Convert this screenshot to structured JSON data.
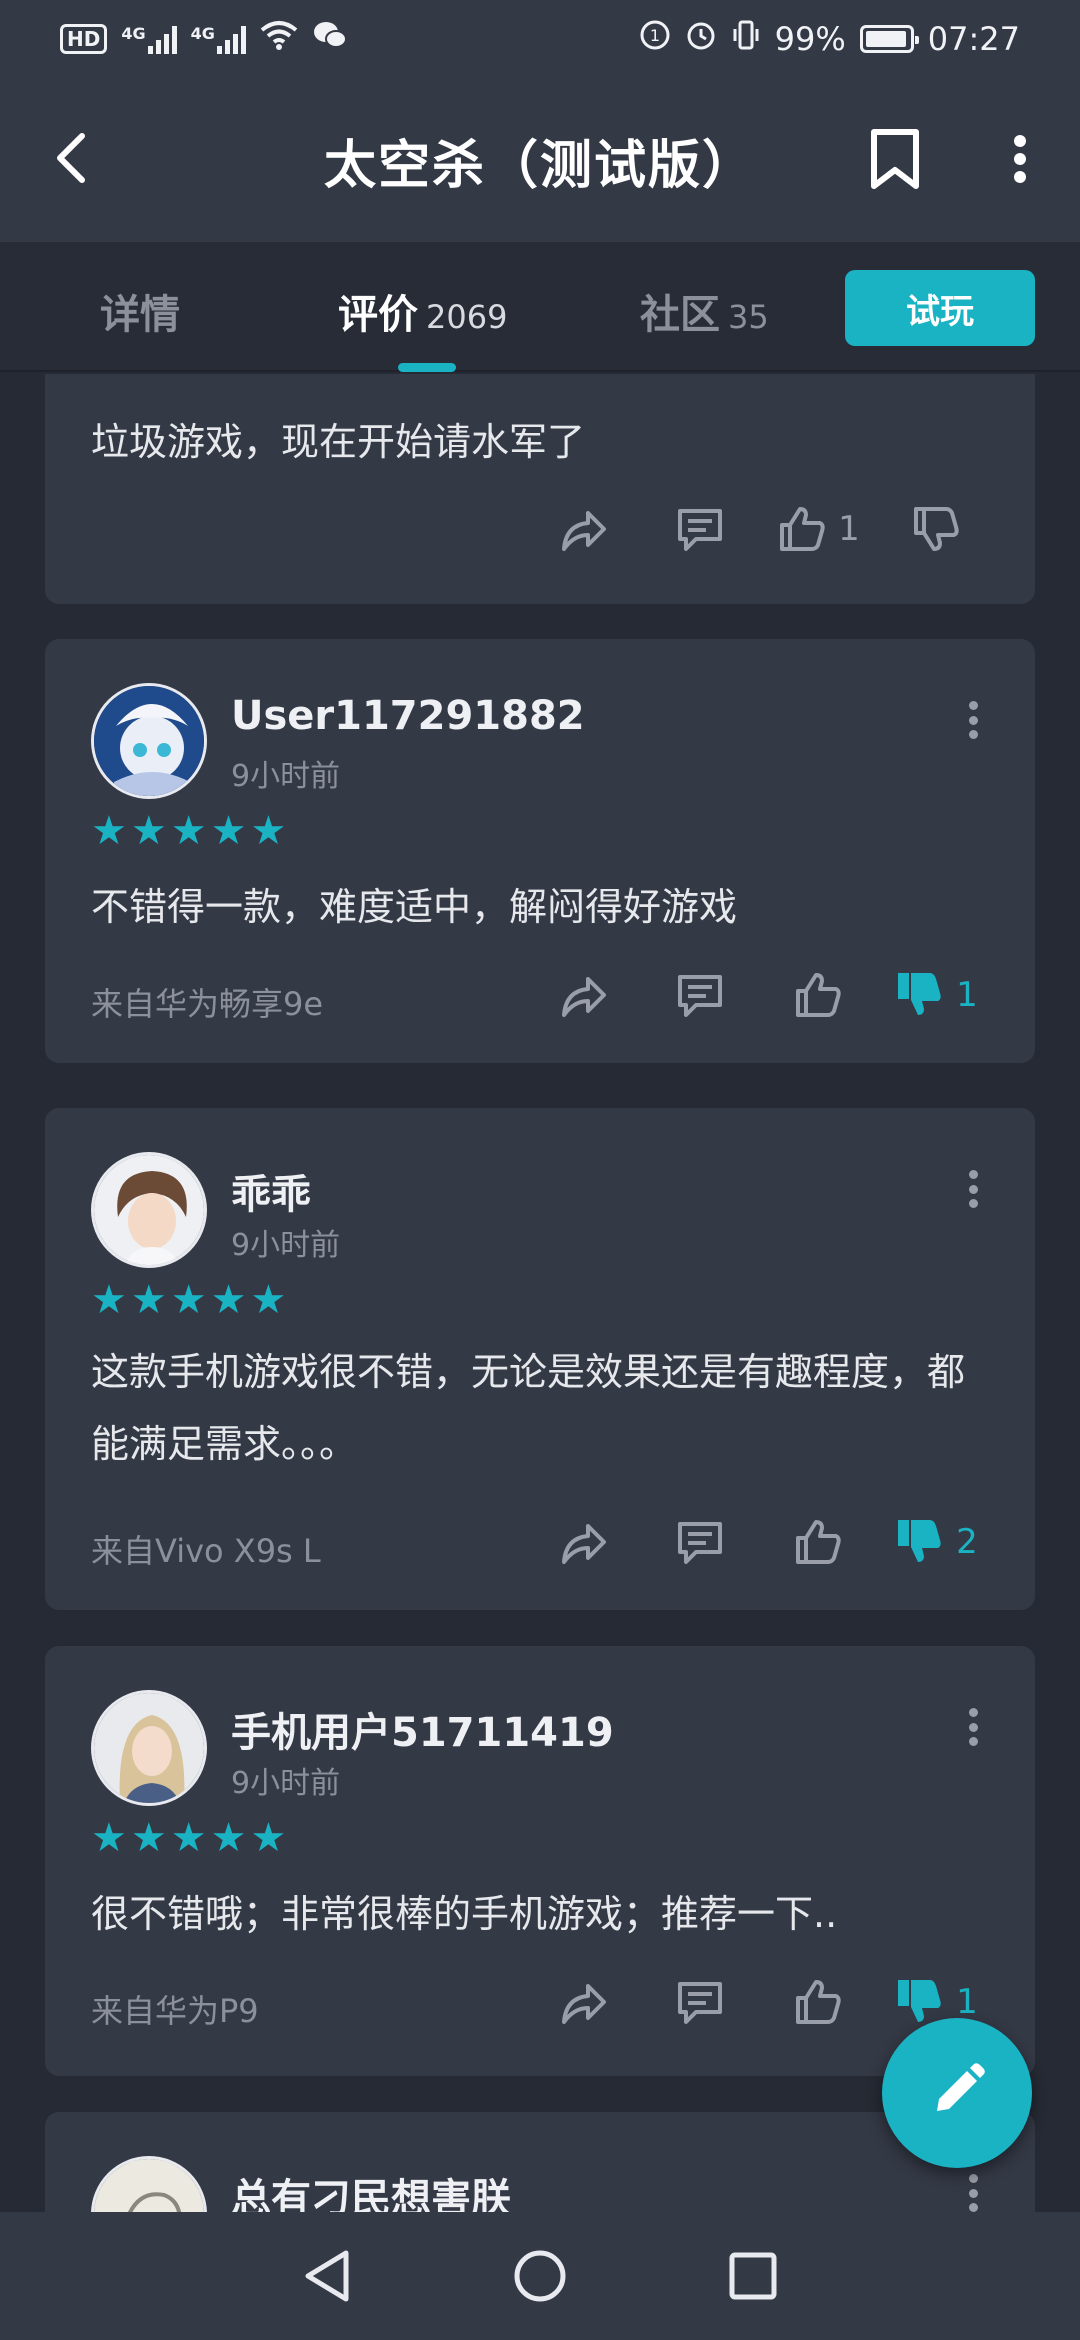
{
  "status_bar": {
    "hd": "HD",
    "net1": "4G",
    "net2": "4G",
    "battery": "99%",
    "time": "07:27"
  },
  "header": {
    "title": "太空杀（测试版）"
  },
  "tabs": [
    {
      "label": "详情",
      "count": ""
    },
    {
      "label": "评价",
      "count": "2069"
    },
    {
      "label": "社区",
      "count": "35"
    }
  ],
  "try_button": "试玩",
  "reviews": [
    {
      "text": "垃圾游戏，现在开始请水军了",
      "likes": "1",
      "dislikes": ""
    },
    {
      "name": "User117291882",
      "time": "9小时前",
      "rating": 5,
      "text": "不错得一款，难度适中，解闷得好游戏",
      "device": "来自华为畅享9e",
      "likes": "",
      "dislikes": "1"
    },
    {
      "name": "乖乖",
      "time": "9小时前",
      "rating": 5,
      "text": "这款手机游戏很不错，无论是效果还是有趣程度，都能满足需求。。。",
      "device": "来自Vivo X9s L",
      "likes": "",
      "dislikes": "2"
    },
    {
      "name": "手机用户51711419",
      "time": "9小时前",
      "rating": 5,
      "text": "很不错哦；非常很棒的手机游戏；推荐一下..",
      "device": "来自华为P9",
      "likes": "",
      "dislikes": "1"
    },
    {
      "name": "总有刁民想害朕"
    }
  ],
  "icons": [
    "back-icon",
    "bookmark-icon",
    "more-icon",
    "share-icon",
    "comment-icon",
    "thumbs-up-icon",
    "thumbs-down-icon",
    "edit-icon",
    "nav-back-icon",
    "nav-home-icon",
    "nav-recents-icon"
  ],
  "colors": {
    "accent": "#1ab3c4",
    "card": "#343946",
    "background": "#262a34"
  }
}
